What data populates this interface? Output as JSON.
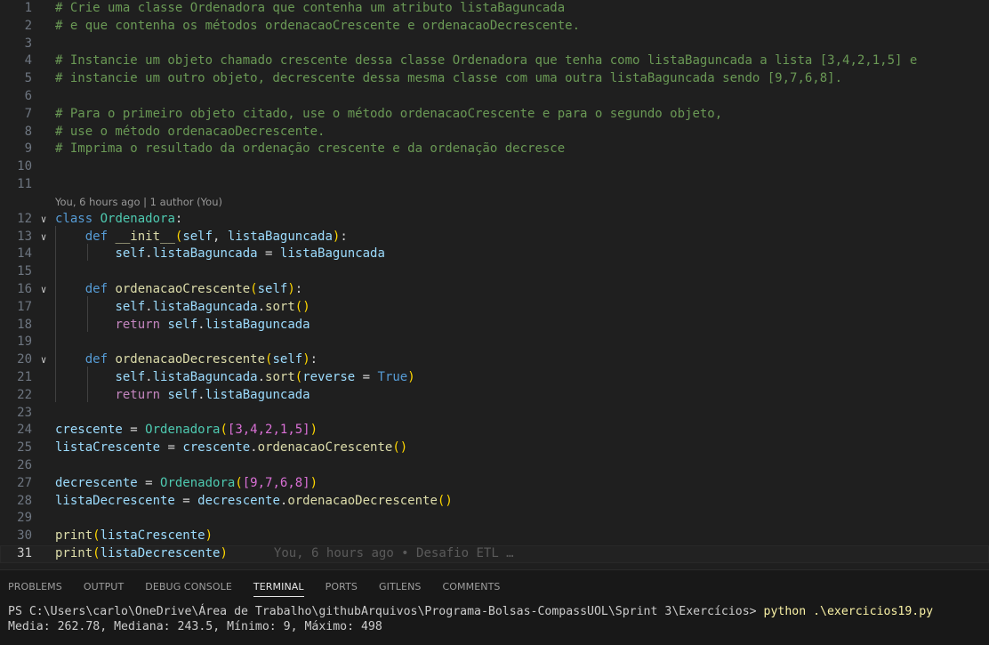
{
  "editor": {
    "codelens": "You, 6 hours ago | 1 author (You)",
    "blame_current_line": "You, 6 hours ago • Desafio ETL …",
    "current_line": 31,
    "lines": [
      {
        "n": "1"
      },
      {
        "n": "2"
      },
      {
        "n": "3"
      },
      {
        "n": "4"
      },
      {
        "n": "5"
      },
      {
        "n": "6"
      },
      {
        "n": "7"
      },
      {
        "n": "8"
      },
      {
        "n": "9"
      },
      {
        "n": "10"
      },
      {
        "n": "11"
      },
      {
        "n": "12"
      },
      {
        "n": "13"
      },
      {
        "n": "14"
      },
      {
        "n": "15"
      },
      {
        "n": "16"
      },
      {
        "n": "17"
      },
      {
        "n": "18"
      },
      {
        "n": "19"
      },
      {
        "n": "20"
      },
      {
        "n": "21"
      },
      {
        "n": "22"
      },
      {
        "n": "23"
      },
      {
        "n": "24"
      },
      {
        "n": "25"
      },
      {
        "n": "26"
      },
      {
        "n": "27"
      },
      {
        "n": "28"
      },
      {
        "n": "29"
      },
      {
        "n": "30"
      },
      {
        "n": "31"
      }
    ],
    "code": {
      "l1": "# Crie uma classe Ordenadora que contenha um atributo listaBaguncada",
      "l2": "# e que contenha os métodos ordenacaoCrescente e ordenacaoDecrescente.",
      "l4": "# Instancie um objeto chamado crescente dessa classe Ordenadora que tenha como listaBaguncada a lista [3,4,2,1,5] e",
      "l5": "# instancie um outro objeto, decrescente dessa mesma classe com uma outra listaBaguncada sendo [9,7,6,8].",
      "l7": "# Para o primeiro objeto citado, use o método ordenacaoCrescente e para o segundo objeto,",
      "l8": "# use o método ordenacaoDecrescente.",
      "l9": "# Imprima o resultado da ordenação crescente e da ordenação decresce",
      "kw_class": "class",
      "kw_def": "def",
      "kw_return": "return",
      "kw_true": "True",
      "cls_name": "Ordenadora",
      "fn_init": "__init__",
      "fn_cresc": "ordenacaoCrescente",
      "fn_decresc": "ordenacaoDecrescente",
      "fn_sort": "sort",
      "fn_print": "print",
      "v_self": "self",
      "v_lista": "listaBaguncada",
      "v_reverse": "reverse",
      "v_crescente": "crescente",
      "v_decrescente": "decrescente",
      "v_listaCrescente": "listaCrescente",
      "v_listaDecrescente": "listaDecrescente",
      "list_a": "[3,4,2,1,5]",
      "list_b": "[9,7,6,8]"
    }
  },
  "panel": {
    "tabs": [
      "PROBLEMS",
      "OUTPUT",
      "DEBUG CONSOLE",
      "TERMINAL",
      "PORTS",
      "GITLENS",
      "COMMENTS"
    ],
    "active_tab": "TERMINAL",
    "terminal": {
      "prompt": "PS C:\\Users\\carlo\\OneDrive\\Área de Trabalho\\githubArquivos\\Programa-Bolsas-CompassUOL\\Sprint 3\\Exercícios> ",
      "command": "python .\\exercicios19.py",
      "output": "Media: 262.78, Mediana: 243.5, Mínimo: 9, Máximo: 498"
    }
  },
  "colors": {
    "background": "#1f1f1f",
    "comment": "#6a9955",
    "keyword": "#569cd6",
    "control": "#c586c0",
    "class": "#4ec9b0",
    "function": "#dcdcaa",
    "variable": "#9cdcfe"
  },
  "icons": {
    "fold": "chevron-down-icon"
  }
}
